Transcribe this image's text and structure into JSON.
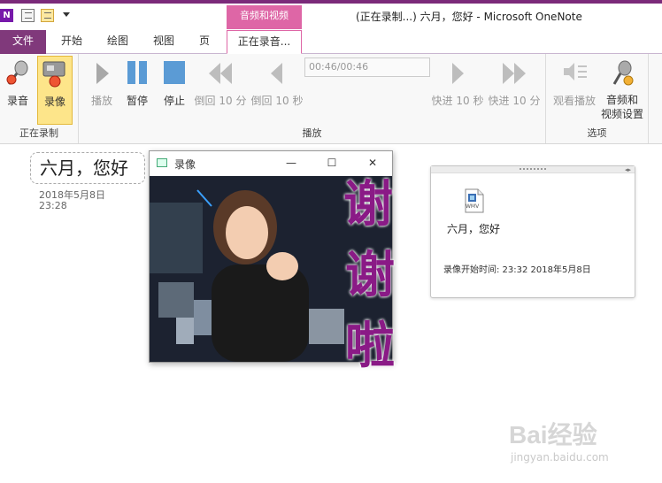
{
  "titlebar": {
    "app_icon": "N",
    "context_group": "音频和视频",
    "window_title": "(正在录制...) 六月，您好 - Microsoft OneNote"
  },
  "tabs": {
    "file": "文件",
    "home": "开始",
    "draw": "绘图",
    "view": "视图",
    "page": "页",
    "recording": "正在录音..."
  },
  "ribbon": {
    "group_recording": {
      "label": "正在录制",
      "record_audio": "录音",
      "record_video": "录像"
    },
    "group_playback": {
      "label": "播放",
      "play": "播放",
      "pause": "暂停",
      "stop": "停止",
      "rewind_10m": "倒回 10 分",
      "rewind_10s": "倒回 10 秒",
      "time": "00:46/00:46",
      "forward_10s": "快进 10 秒",
      "forward_10m": "快进 10 分"
    },
    "group_options": {
      "label": "选项",
      "see_playback": "观看播放",
      "av_settings_line1": "音频和",
      "av_settings_line2": "视频设置"
    }
  },
  "note": {
    "title": "六月，您好",
    "date": "2018年5月8日",
    "time": "23:28"
  },
  "video_window": {
    "title": "录像",
    "minimize": "—",
    "maximize": "☐",
    "close": "✕"
  },
  "sticker": {
    "chars": [
      "谢",
      "谢",
      "啦"
    ],
    "color": "#8a1a86"
  },
  "file_card": {
    "icon_label": "WMV",
    "name": "六月，您好",
    "meta": "录像开始时间: 23:32 2018年5月8日"
  },
  "watermark": {
    "main": "Bai经验",
    "sub": "jingyan.baidu.com"
  },
  "colors": {
    "accent": "#80397b",
    "context_pink": "#de66a6",
    "selected_button": "#fde58a",
    "icon_blue": "#5b9bd5"
  }
}
